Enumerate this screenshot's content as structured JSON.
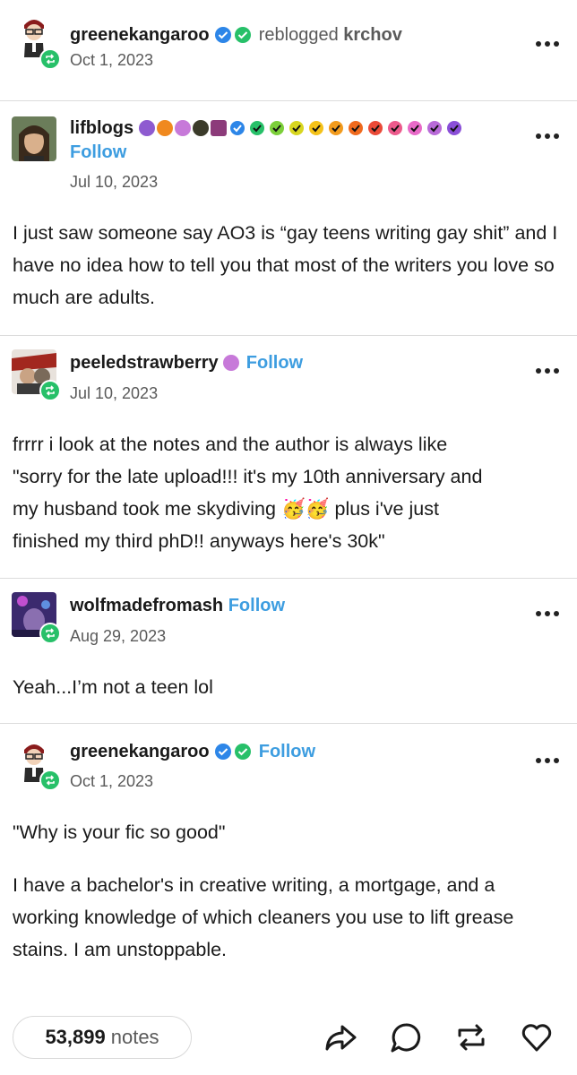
{
  "reblog_header": {
    "username": "greenekangaroo",
    "action": "reblogged",
    "source": "krchov",
    "date": "Oct 1, 2023"
  },
  "posts": [
    {
      "username": "lifblogs",
      "follow": "Follow",
      "date": "Jul 10, 2023",
      "text": "I just saw someone say AO3 is “gay teens writing gay shit” and I have no idea how to tell you that most of the writers you love so much are adults."
    },
    {
      "username": "peeledstrawberry",
      "follow": "Follow",
      "date": "Jul 10, 2023",
      "text_line1": "frrrr i look at the notes and the author is always like",
      "text_line2": "\"sorry for the late upload!!! it's my 10th anniversary and",
      "text_line3a": "my husband took me skydiving",
      "emoji": "🥳🥳",
      "text_line3b": "plus i've just",
      "text_line4": "finished my third phD!! anyways here's 30k\""
    },
    {
      "username": "wolfmadefromash",
      "follow": "Follow",
      "date": "Aug 29, 2023",
      "text": "Yeah...I’m not a teen lol"
    },
    {
      "username": "greenekangaroo",
      "follow": "Follow",
      "date": "Oct 1, 2023",
      "text_p1": "\"Why is your fic so good\"",
      "text_p2": "I have a bachelor's in creative writing, a mortgage, and a working knowledge of which cleaners you use to lift grease stains. I am unstoppable."
    }
  ],
  "footer": {
    "notes_count": "53,899",
    "notes_label": "notes"
  },
  "colors": {
    "follow": "#3d9de0",
    "reblog_badge": "#27c069",
    "verified_blue": "#2d86e8",
    "verified_green": "#27c069",
    "separator": "#dcdcdc"
  },
  "icons": [
    "more-icon",
    "reblog-badge-icon",
    "verified-blue-icon",
    "verified-green-icon",
    "share-icon",
    "reply-icon",
    "reblog-icon",
    "like-icon"
  ]
}
